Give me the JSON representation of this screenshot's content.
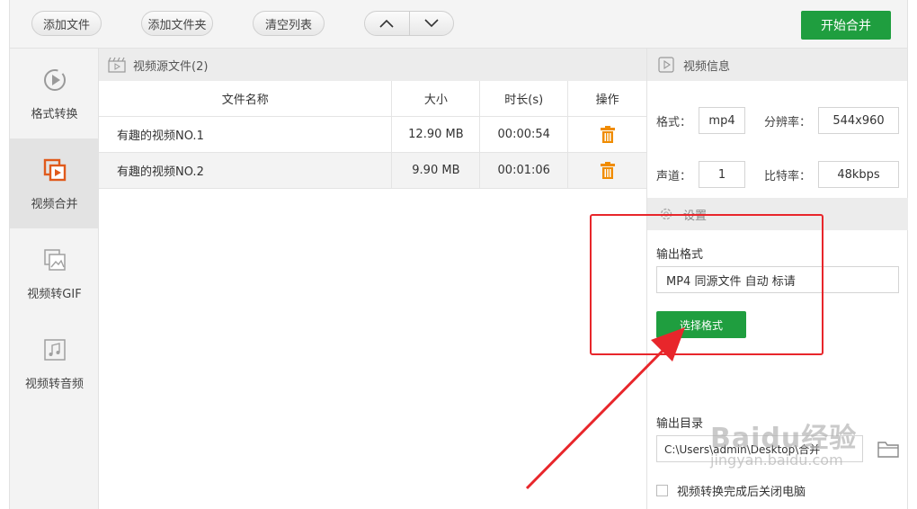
{
  "toolbar": {
    "add_file": "添加文件",
    "add_folder": "添加文件夹",
    "clear_list": "清空列表",
    "start_merge": "开始合并"
  },
  "sidebar": {
    "items": [
      {
        "label": "格式转换",
        "icon": "play-circle-icon",
        "active": false
      },
      {
        "label": "视频合并",
        "icon": "merge-video-icon",
        "active": true
      },
      {
        "label": "视频转GIF",
        "icon": "image-icon",
        "active": false
      },
      {
        "label": "视频转音频",
        "icon": "music-note-icon",
        "active": false
      }
    ]
  },
  "files": {
    "header": "视频源文件(2)",
    "columns": [
      "文件名称",
      "大小",
      "时长(s)",
      "操作"
    ],
    "rows": [
      {
        "name": "有趣的视频NO.1",
        "size": "12.90 MB",
        "duration": "00:00:54"
      },
      {
        "name": "有趣的视频NO.2",
        "size": "9.90 MB",
        "duration": "00:01:06"
      }
    ]
  },
  "video_info": {
    "header": "视频信息",
    "format_label": "格式：",
    "format_value": "mp4",
    "resolution_label": "分辨率：",
    "resolution_value": "544x960",
    "channel_label": "声道：",
    "channel_value": "1",
    "bitrate_label": "比特率：",
    "bitrate_value": "48kbps"
  },
  "settings": {
    "header": "设置",
    "output_format_label": "输出格式",
    "output_format_value": "MP4 同源文件 自动 标请",
    "choose_format": "选择格式",
    "output_dir_label": "输出目录",
    "output_dir_value": "C:\\Users\\admin\\Desktop\\合并",
    "shutdown_label": "视频转换完成后关闭电脑"
  },
  "watermark": {
    "big": "Baidu经验",
    "small": "jingyan.baidu.com"
  },
  "colors": {
    "accent_green": "#1f9e3f",
    "annotation_red": "#e8262b",
    "trash_orange": "#f08c00"
  }
}
